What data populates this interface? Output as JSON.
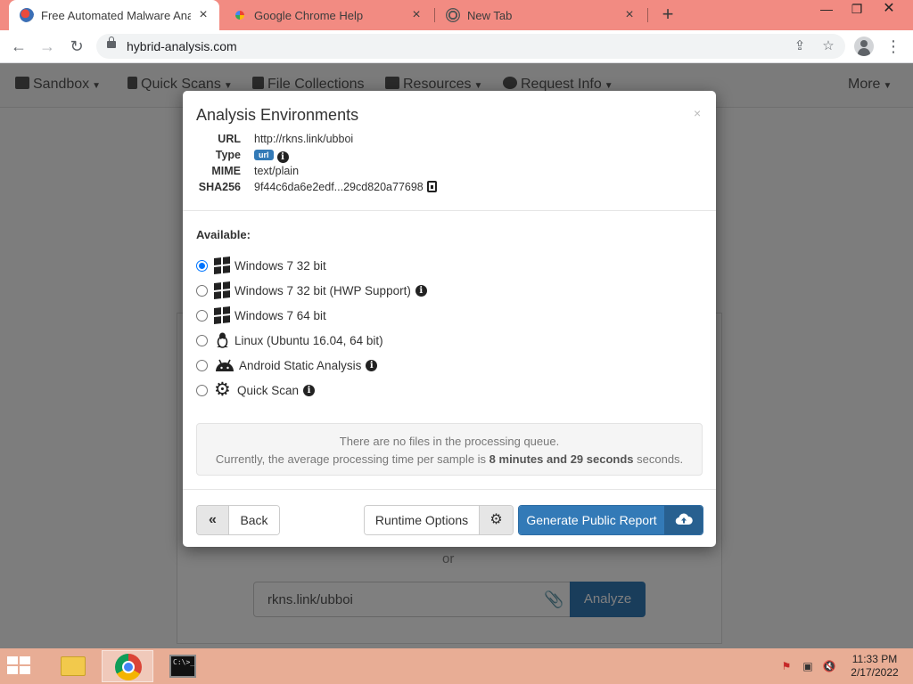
{
  "browser": {
    "tabs": [
      {
        "title": "Free Automated Malware Analysi",
        "active": true
      },
      {
        "title": "Google Chrome Help",
        "active": false
      },
      {
        "title": "New Tab",
        "active": false
      }
    ],
    "url": "hybrid-analysis.com"
  },
  "site_nav": {
    "items": [
      "Sandbox",
      "Quick Scans",
      "File Collections",
      "Resources",
      "Request Info"
    ],
    "more": "More"
  },
  "page": {
    "or_text": "or",
    "url_value": "rkns.link/ubboi",
    "analyze_label": "Analyze"
  },
  "modal": {
    "title": "Analysis Environments",
    "close_glyph": "×",
    "meta": {
      "url_key": "URL",
      "url_value": "http://rkns.link/ubboi",
      "type_key": "Type",
      "type_badge": "url",
      "mime_key": "MIME",
      "mime_value": "text/plain",
      "sha_key": "SHA256",
      "sha_value": "9f44c6da6e2edf...29cd820a77698"
    },
    "available_label": "Available:",
    "environments": [
      {
        "label": "Windows 7 32 bit",
        "icon": "windows-icon",
        "checked": true,
        "info": false
      },
      {
        "label": "Windows 7 32 bit (HWP Support)",
        "icon": "windows-icon",
        "checked": false,
        "info": true
      },
      {
        "label": "Windows 7 64 bit",
        "icon": "windows-icon",
        "checked": false,
        "info": false
      },
      {
        "label": "Linux (Ubuntu 16.04, 64 bit)",
        "icon": "linux-icon",
        "checked": false,
        "info": false
      },
      {
        "label": "Android Static Analysis",
        "icon": "android-icon",
        "checked": false,
        "info": true
      },
      {
        "label": "Quick Scan",
        "icon": "gear-icon",
        "checked": false,
        "info": true
      }
    ],
    "queue": {
      "line1": "There are no files in the processing queue.",
      "line2_prefix": "Currently, the average processing time per sample is ",
      "line2_bold": "8 minutes and 29 seconds",
      "line2_suffix": " seconds."
    },
    "footer": {
      "back_label": "Back",
      "runtime_label": "Runtime Options",
      "generate_label": "Generate Public Report"
    }
  },
  "taskbar": {
    "time": "11:33 PM",
    "date": "2/17/2022",
    "cmd_text": "C:\\>_"
  },
  "colors": {
    "tabstrip": "#f28b82",
    "primary": "#337ab7",
    "taskbar": "#e8ad95"
  }
}
